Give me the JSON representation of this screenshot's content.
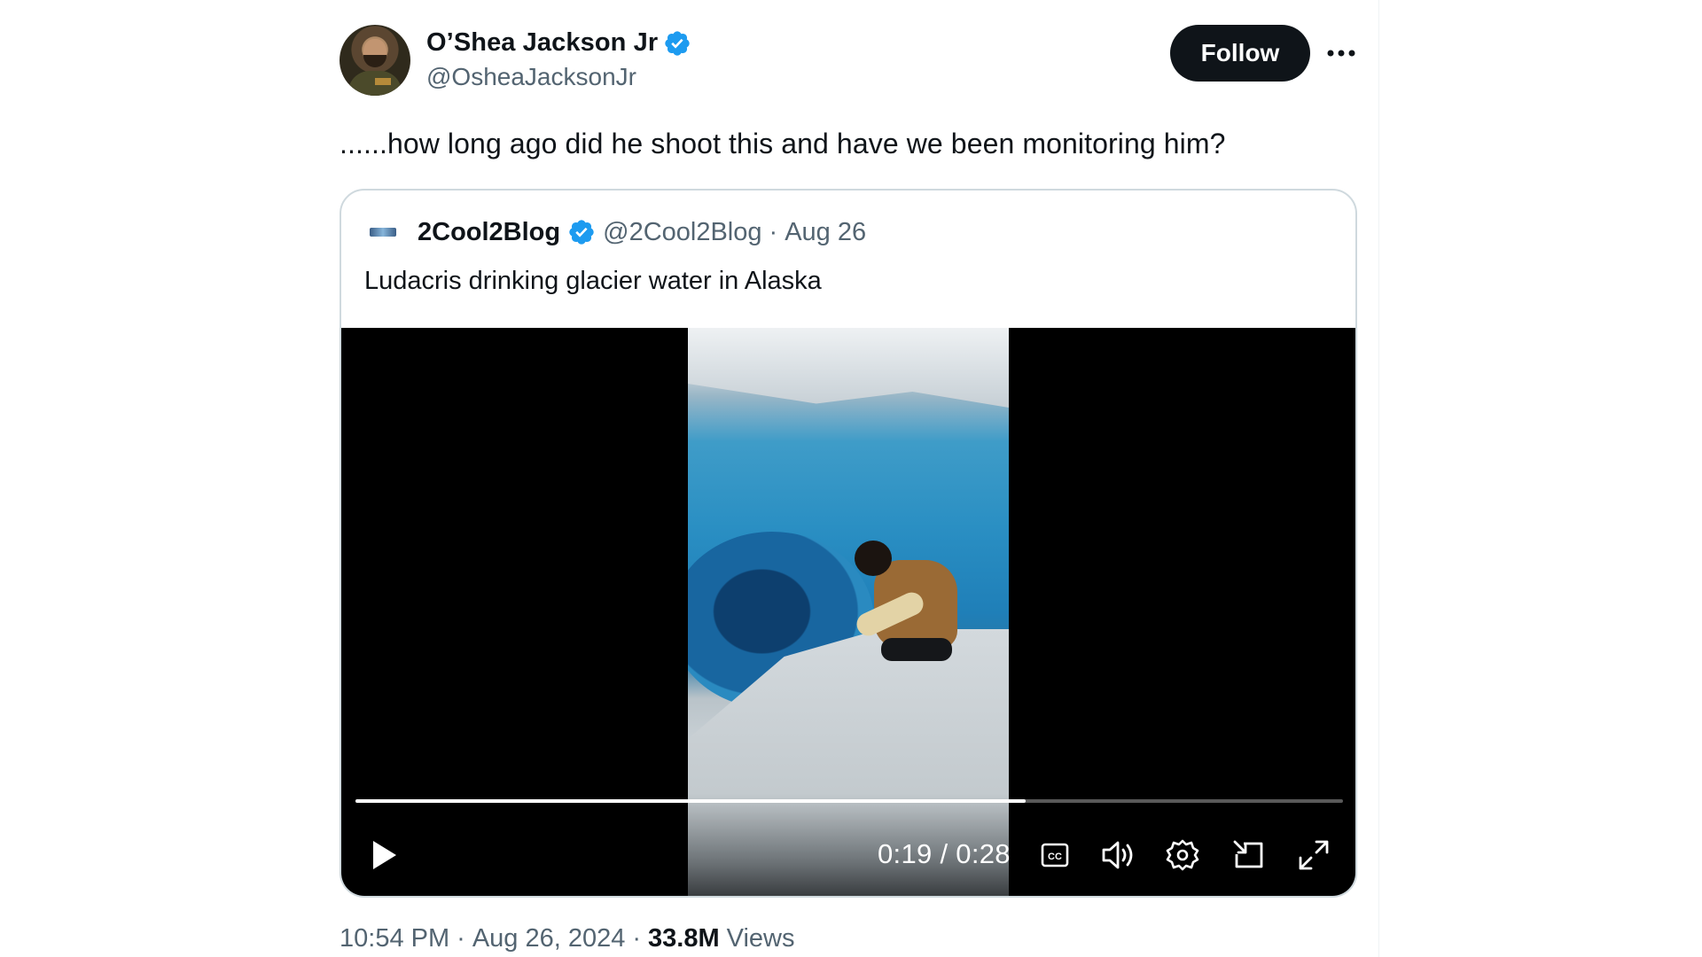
{
  "author": {
    "display_name": "O’Shea Jackson Jr",
    "handle": "@OsheaJacksonJr",
    "verified": true
  },
  "follow_label": "Follow",
  "more_icon": "more-horizontal-icon",
  "tweet_text": "......how long ago did he shoot this and have we been monitoring him?",
  "quoted": {
    "display_name": "2Cool2Blog",
    "handle": "@2Cool2Blog",
    "separator": "·",
    "date": "Aug 26",
    "text": "Ludacris drinking glacier water in Alaska",
    "verified": true
  },
  "video": {
    "current_time": "0:19",
    "duration": "0:28",
    "time_display": "0:19 / 0:28",
    "progress_fraction": 0.679,
    "controls": [
      "play-icon",
      "captions-icon",
      "volume-icon",
      "settings-icon",
      "pip-icon",
      "fullscreen-icon"
    ]
  },
  "meta": {
    "time": "10:54 PM",
    "sep1": "·",
    "date": "Aug 26, 2024",
    "sep2": "·",
    "views_count": "33.8M",
    "views_label": "Views"
  },
  "colors": {
    "verified": "#1d9bf0",
    "follow_bg": "#0f1419",
    "secondary_text": "#536471",
    "border": "#cfd9de"
  }
}
